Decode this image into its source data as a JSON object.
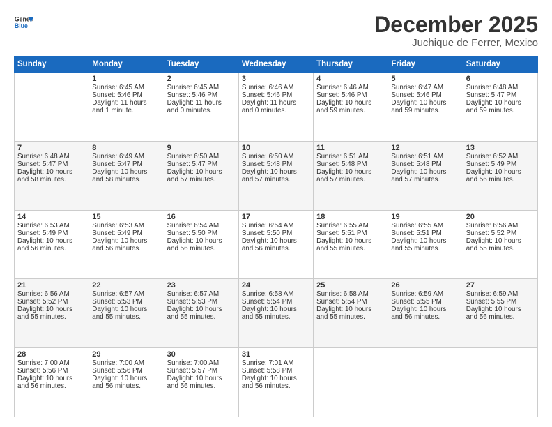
{
  "header": {
    "logo_line1": "General",
    "logo_line2": "Blue",
    "title": "December 2025",
    "subtitle": "Juchique de Ferrer, Mexico"
  },
  "weekdays": [
    "Sunday",
    "Monday",
    "Tuesday",
    "Wednesday",
    "Thursday",
    "Friday",
    "Saturday"
  ],
  "rows": [
    [
      {
        "day": "",
        "info": ""
      },
      {
        "day": "1",
        "info": "Sunrise: 6:45 AM\nSunset: 5:46 PM\nDaylight: 11 hours\nand 1 minute."
      },
      {
        "day": "2",
        "info": "Sunrise: 6:45 AM\nSunset: 5:46 PM\nDaylight: 11 hours\nand 0 minutes."
      },
      {
        "day": "3",
        "info": "Sunrise: 6:46 AM\nSunset: 5:46 PM\nDaylight: 11 hours\nand 0 minutes."
      },
      {
        "day": "4",
        "info": "Sunrise: 6:46 AM\nSunset: 5:46 PM\nDaylight: 10 hours\nand 59 minutes."
      },
      {
        "day": "5",
        "info": "Sunrise: 6:47 AM\nSunset: 5:46 PM\nDaylight: 10 hours\nand 59 minutes."
      },
      {
        "day": "6",
        "info": "Sunrise: 6:48 AM\nSunset: 5:47 PM\nDaylight: 10 hours\nand 59 minutes."
      }
    ],
    [
      {
        "day": "7",
        "info": "Sunrise: 6:48 AM\nSunset: 5:47 PM\nDaylight: 10 hours\nand 58 minutes."
      },
      {
        "day": "8",
        "info": "Sunrise: 6:49 AM\nSunset: 5:47 PM\nDaylight: 10 hours\nand 58 minutes."
      },
      {
        "day": "9",
        "info": "Sunrise: 6:50 AM\nSunset: 5:47 PM\nDaylight: 10 hours\nand 57 minutes."
      },
      {
        "day": "10",
        "info": "Sunrise: 6:50 AM\nSunset: 5:48 PM\nDaylight: 10 hours\nand 57 minutes."
      },
      {
        "day": "11",
        "info": "Sunrise: 6:51 AM\nSunset: 5:48 PM\nDaylight: 10 hours\nand 57 minutes."
      },
      {
        "day": "12",
        "info": "Sunrise: 6:51 AM\nSunset: 5:48 PM\nDaylight: 10 hours\nand 57 minutes."
      },
      {
        "day": "13",
        "info": "Sunrise: 6:52 AM\nSunset: 5:49 PM\nDaylight: 10 hours\nand 56 minutes."
      }
    ],
    [
      {
        "day": "14",
        "info": "Sunrise: 6:53 AM\nSunset: 5:49 PM\nDaylight: 10 hours\nand 56 minutes."
      },
      {
        "day": "15",
        "info": "Sunrise: 6:53 AM\nSunset: 5:49 PM\nDaylight: 10 hours\nand 56 minutes."
      },
      {
        "day": "16",
        "info": "Sunrise: 6:54 AM\nSunset: 5:50 PM\nDaylight: 10 hours\nand 56 minutes."
      },
      {
        "day": "17",
        "info": "Sunrise: 6:54 AM\nSunset: 5:50 PM\nDaylight: 10 hours\nand 56 minutes."
      },
      {
        "day": "18",
        "info": "Sunrise: 6:55 AM\nSunset: 5:51 PM\nDaylight: 10 hours\nand 55 minutes."
      },
      {
        "day": "19",
        "info": "Sunrise: 6:55 AM\nSunset: 5:51 PM\nDaylight: 10 hours\nand 55 minutes."
      },
      {
        "day": "20",
        "info": "Sunrise: 6:56 AM\nSunset: 5:52 PM\nDaylight: 10 hours\nand 55 minutes."
      }
    ],
    [
      {
        "day": "21",
        "info": "Sunrise: 6:56 AM\nSunset: 5:52 PM\nDaylight: 10 hours\nand 55 minutes."
      },
      {
        "day": "22",
        "info": "Sunrise: 6:57 AM\nSunset: 5:53 PM\nDaylight: 10 hours\nand 55 minutes."
      },
      {
        "day": "23",
        "info": "Sunrise: 6:57 AM\nSunset: 5:53 PM\nDaylight: 10 hours\nand 55 minutes."
      },
      {
        "day": "24",
        "info": "Sunrise: 6:58 AM\nSunset: 5:54 PM\nDaylight: 10 hours\nand 55 minutes."
      },
      {
        "day": "25",
        "info": "Sunrise: 6:58 AM\nSunset: 5:54 PM\nDaylight: 10 hours\nand 55 minutes."
      },
      {
        "day": "26",
        "info": "Sunrise: 6:59 AM\nSunset: 5:55 PM\nDaylight: 10 hours\nand 56 minutes."
      },
      {
        "day": "27",
        "info": "Sunrise: 6:59 AM\nSunset: 5:55 PM\nDaylight: 10 hours\nand 56 minutes."
      }
    ],
    [
      {
        "day": "28",
        "info": "Sunrise: 7:00 AM\nSunset: 5:56 PM\nDaylight: 10 hours\nand 56 minutes."
      },
      {
        "day": "29",
        "info": "Sunrise: 7:00 AM\nSunset: 5:56 PM\nDaylight: 10 hours\nand 56 minutes."
      },
      {
        "day": "30",
        "info": "Sunrise: 7:00 AM\nSunset: 5:57 PM\nDaylight: 10 hours\nand 56 minutes."
      },
      {
        "day": "31",
        "info": "Sunrise: 7:01 AM\nSunset: 5:58 PM\nDaylight: 10 hours\nand 56 minutes."
      },
      {
        "day": "",
        "info": ""
      },
      {
        "day": "",
        "info": ""
      },
      {
        "day": "",
        "info": ""
      }
    ]
  ]
}
